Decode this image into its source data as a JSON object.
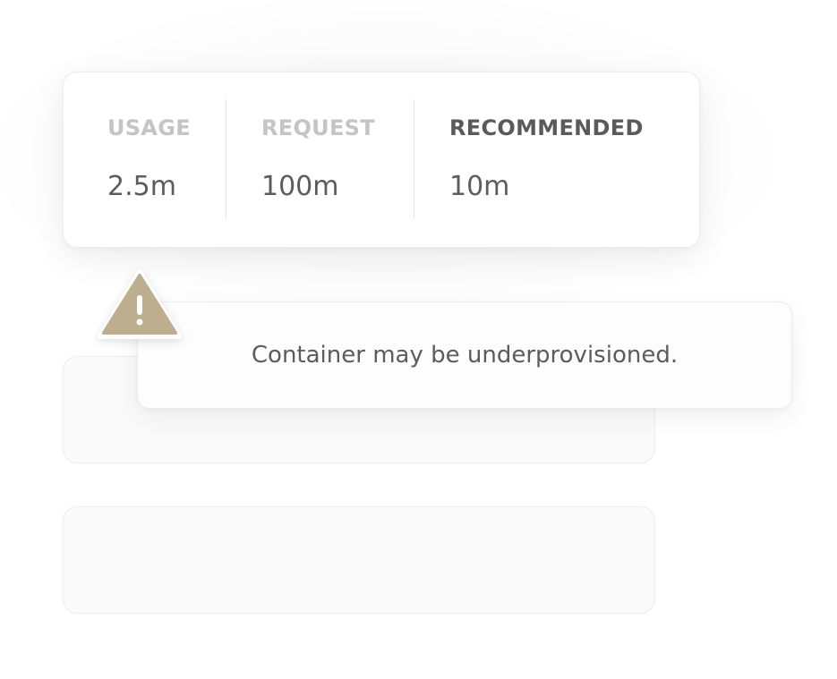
{
  "stats": {
    "usage": {
      "label": "USAGE",
      "value": "2.5m"
    },
    "request": {
      "label": "REQUEST",
      "value": "100m"
    },
    "recommended": {
      "label": "RECOMMENDED",
      "value": "10m"
    }
  },
  "alert": {
    "message": "Container may be underprovisioned.",
    "icon": "warning-icon",
    "icon_color": "#bcae8e"
  },
  "colors": {
    "label_muted": "#c4c4c4",
    "label_active": "#5a5a5a",
    "value_text": "#5c5c5c"
  }
}
